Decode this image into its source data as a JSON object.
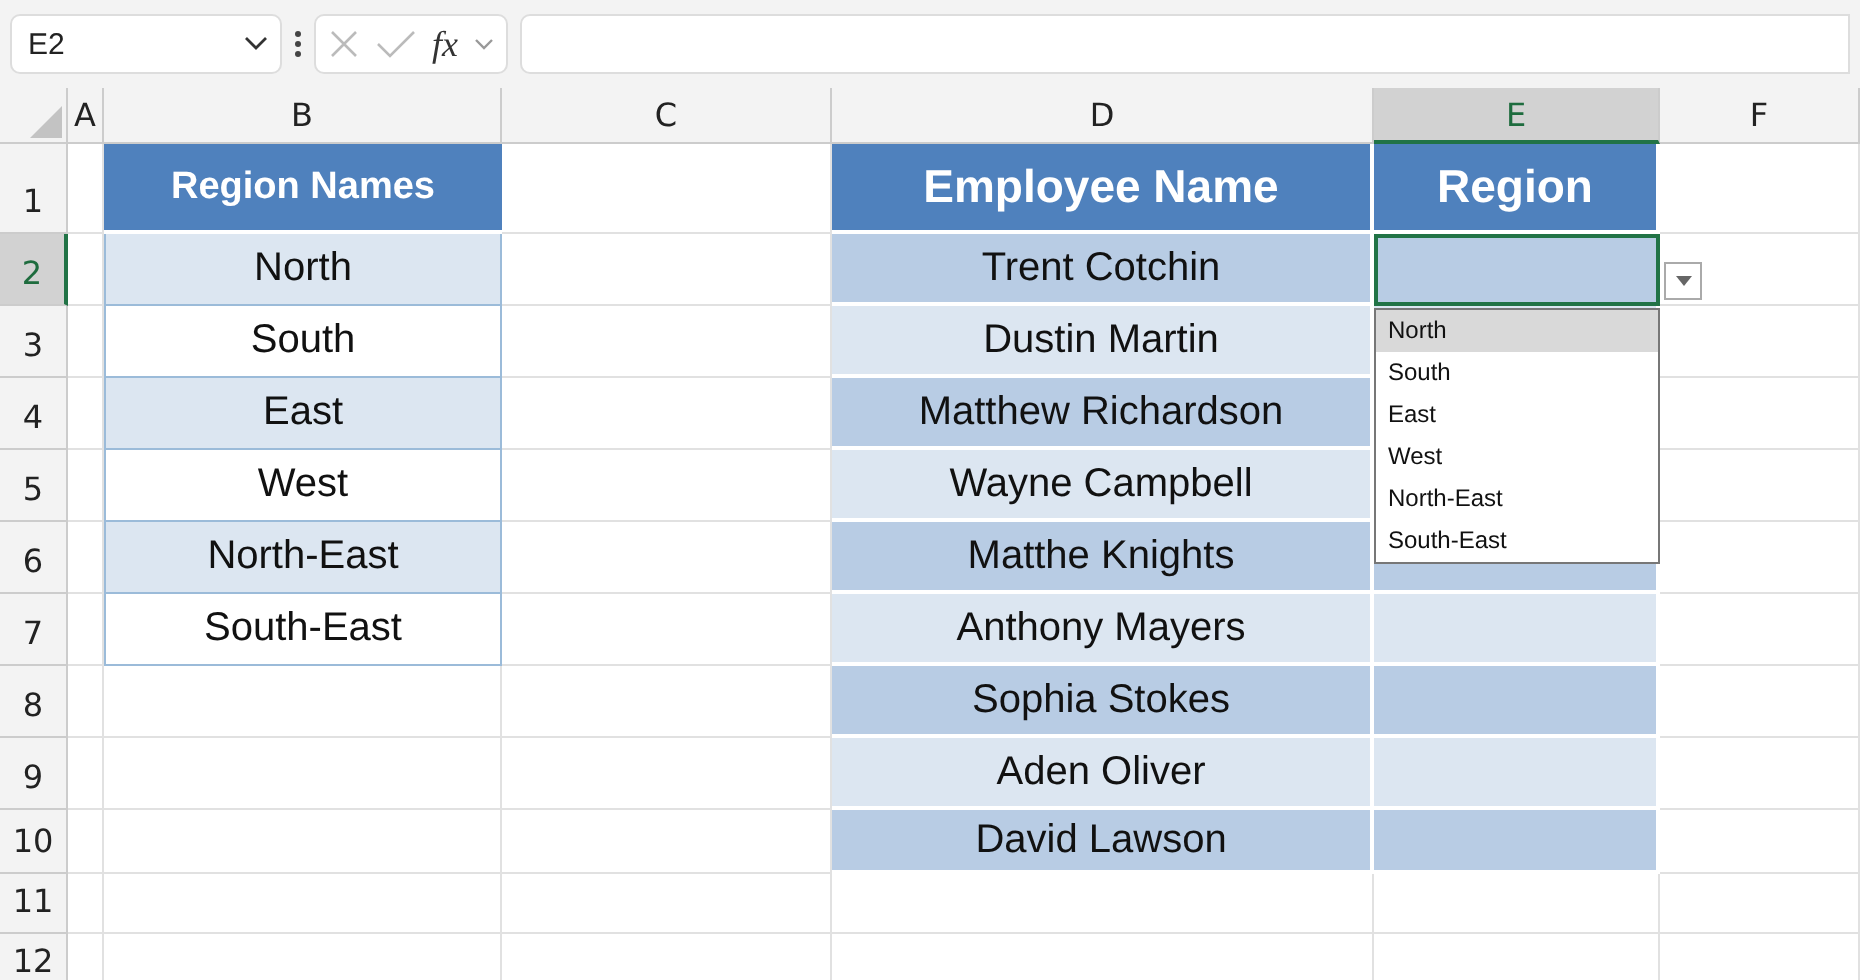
{
  "formula_bar": {
    "name_box": "E2",
    "function_label": "fx"
  },
  "columns": [
    {
      "label": "A",
      "selected": false
    },
    {
      "label": "B",
      "selected": false
    },
    {
      "label": "C",
      "selected": false
    },
    {
      "label": "D",
      "selected": false
    },
    {
      "label": "E",
      "selected": true
    },
    {
      "label": "F",
      "selected": false
    }
  ],
  "rows": [
    {
      "label": "1",
      "selected": false
    },
    {
      "label": "2",
      "selected": true
    },
    {
      "label": "3",
      "selected": false
    },
    {
      "label": "4",
      "selected": false
    },
    {
      "label": "5",
      "selected": false
    },
    {
      "label": "6",
      "selected": false
    },
    {
      "label": "7",
      "selected": false
    },
    {
      "label": "8",
      "selected": false
    },
    {
      "label": "9",
      "selected": false
    },
    {
      "label": "10",
      "selected": false
    },
    {
      "label": "11",
      "selected": false
    },
    {
      "label": "12",
      "selected": false
    }
  ],
  "region_table": {
    "header": "Region Names",
    "items": [
      "North",
      "South",
      "East",
      "West",
      "North-East",
      "South-East"
    ]
  },
  "employee_table": {
    "headers": [
      "Employee Name",
      "Region"
    ],
    "rows": [
      "Trent Cotchin",
      "Dustin Martin",
      "Matthew Richardson",
      "Wayne Campbell",
      "Matthe Knights",
      "Anthony Mayers",
      "Sophia Stokes",
      "Aden Oliver",
      "David Lawson"
    ]
  },
  "dropdown": {
    "options": [
      {
        "label": "North",
        "selected": true
      },
      {
        "label": "South",
        "selected": false
      },
      {
        "label": "East",
        "selected": false
      },
      {
        "label": "West",
        "selected": false
      },
      {
        "label": "North-East",
        "selected": false
      },
      {
        "label": "South-East",
        "selected": false
      }
    ]
  }
}
